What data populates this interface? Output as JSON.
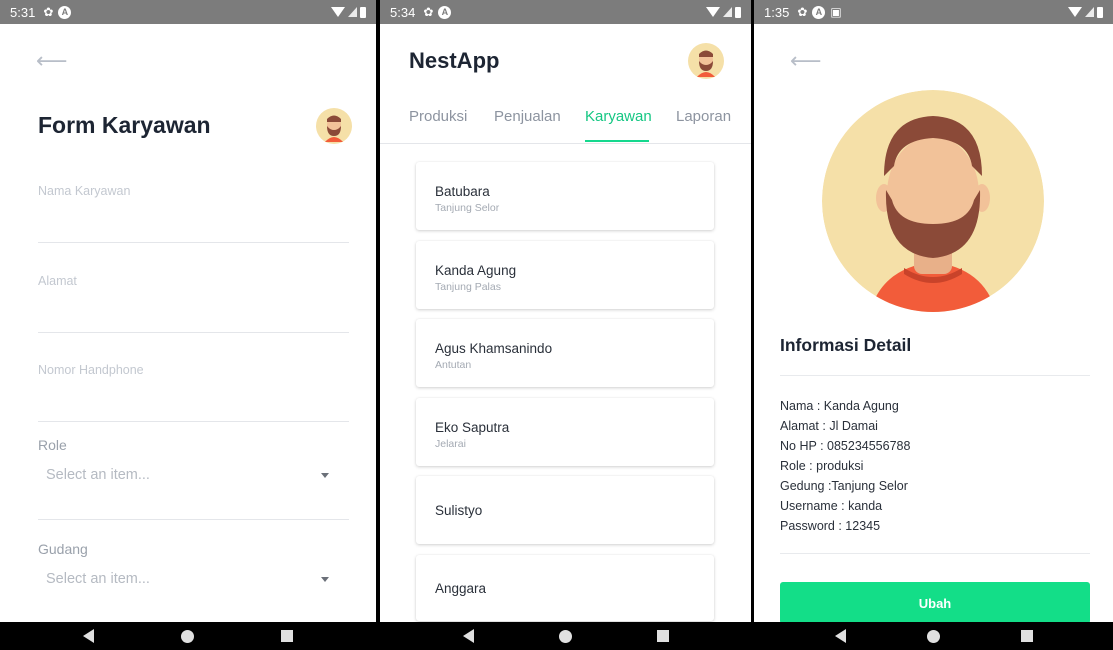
{
  "screens": [
    {
      "status": {
        "time": "5:31"
      },
      "form_title": "Form Karyawan",
      "fields": [
        {
          "placeholder": "Nama Karyawan"
        },
        {
          "placeholder": "Alamat"
        },
        {
          "placeholder": "Nomor Handphone"
        }
      ],
      "selects": [
        {
          "label": "Role",
          "placeholder": "Select an item..."
        },
        {
          "label": "Gudang",
          "placeholder": "Select an item..."
        }
      ]
    },
    {
      "status": {
        "time": "5:34"
      },
      "app_title": "NestApp",
      "tabs": [
        "Produksi",
        "Penjualan",
        "Karyawan",
        "Laporan"
      ],
      "active_tab": "Karyawan",
      "employees": [
        {
          "name": "Batubara",
          "location": "Tanjung Selor"
        },
        {
          "name": "Kanda Agung",
          "location": "Tanjung Palas"
        },
        {
          "name": "Agus Khamsanindo",
          "location": "Antutan"
        },
        {
          "name": "Eko Saputra",
          "location": "Jelarai"
        },
        {
          "name": "Sulistyo",
          "location": ""
        },
        {
          "name": "Anggara",
          "location": ""
        }
      ]
    },
    {
      "status": {
        "time": "1:35"
      },
      "detail_title": "Informasi Detail",
      "details": [
        "Nama : Kanda Agung",
        "Alamat : Jl Damai",
        "No HP : 085234556788",
        "Role : produksi",
        "Gedung :Tanjung Selor",
        "Username : kanda",
        "Password : 12345"
      ],
      "button_label": "Ubah"
    }
  ],
  "colors": {
    "accent": "#13de88",
    "status_bar": "#7c7c7c",
    "title": "#1d2533",
    "placeholder": "#c3c8d0",
    "avatar_bg": "#f5e0a8",
    "skin": "#f2c299",
    "beard": "#8b4a38",
    "shirt": "#f25c3a"
  },
  "icons": [
    "back-arrow-icon",
    "gear-icon",
    "notification-icon",
    "wifi-icon",
    "signal-icon",
    "battery-icon",
    "caret-down-icon",
    "nav-back-icon",
    "nav-home-icon",
    "nav-recents-icon"
  ]
}
